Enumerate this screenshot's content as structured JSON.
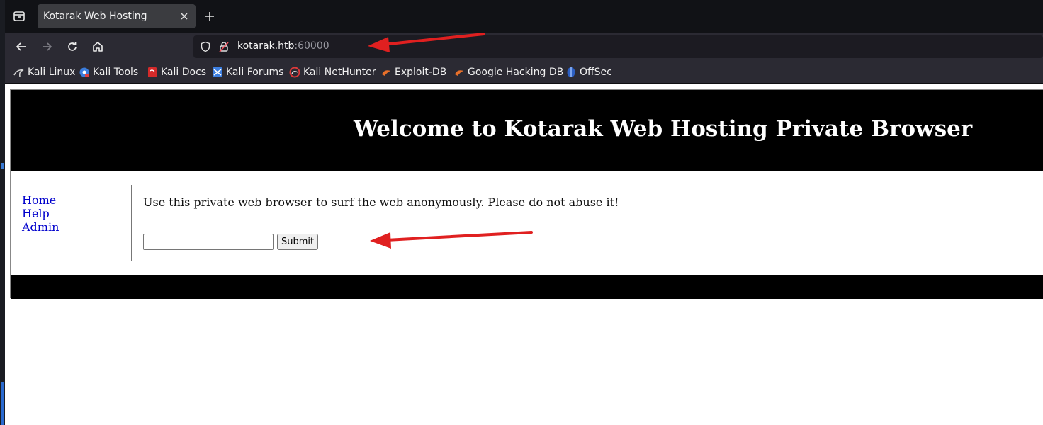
{
  "browser": {
    "tab": {
      "title": "Kotarak Web Hosting"
    },
    "url": {
      "host": "kotarak.htb",
      "port": ":60000"
    },
    "bookmarks": [
      {
        "label": "Kali Linux",
        "icon": "kali-dragon-icon"
      },
      {
        "label": "Kali Tools",
        "icon": "kali-tools-icon"
      },
      {
        "label": "Kali Docs",
        "icon": "kali-docs-icon"
      },
      {
        "label": "Kali Forums",
        "icon": "kali-forums-icon"
      },
      {
        "label": "Kali NetHunter",
        "icon": "nethunter-icon"
      },
      {
        "label": "Exploit-DB",
        "icon": "exploit-db-icon"
      },
      {
        "label": "Google Hacking DB",
        "icon": "ghdb-icon"
      },
      {
        "label": "OffSec",
        "icon": "offsec-icon"
      }
    ]
  },
  "site": {
    "title": "Welcome to Kotarak Web Hosting Private Browser",
    "nav": [
      "Home",
      "Help",
      "Admin"
    ],
    "intro": "Use this private web browser to surf the web anonymously. Please do not abuse it!",
    "input_value": "",
    "submit_label": "Submit"
  },
  "colors": {
    "annotation_arrow": "#e02020",
    "link": "#0000cc",
    "header_bg": "#000000"
  }
}
